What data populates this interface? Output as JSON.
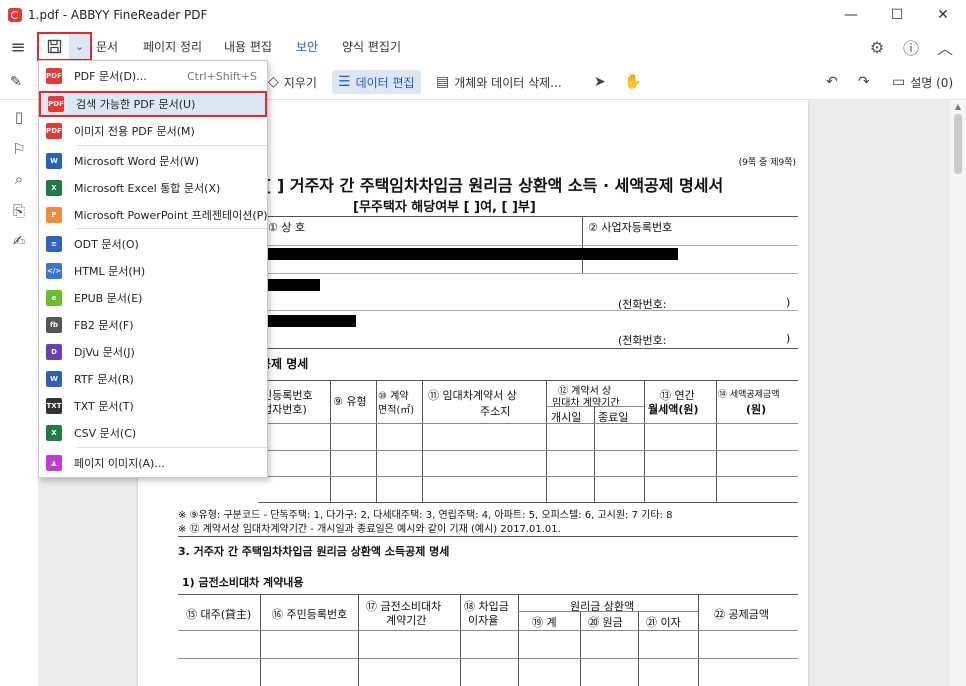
{
  "window": {
    "title": "1.pdf - ABBYY FineReader PDF",
    "minimize": "—",
    "maximize": "☐",
    "close": "✕"
  },
  "menubar": {
    "tabs": [
      "문서",
      "페이지 정리",
      "내용 편집",
      "보안",
      "양식 편집기"
    ],
    "active_tab": "보안"
  },
  "toolbar": {
    "cut_label": "지우기",
    "data_edit_label": "데이터 편집",
    "object_delete_label": "개체와 데이터 삭제...",
    "comments_label": "설명 (0)"
  },
  "colors": {
    "swatches": [
      "#e8191a",
      "#ff9800",
      "#f5e600",
      "#7ed321",
      "#1fd3d8",
      "#2b7de9",
      "#e91ee0"
    ],
    "selected": "#000000",
    "accent": "#1f5fc7",
    "highlight_border": "#e0282e"
  },
  "dropdown": {
    "items": [
      {
        "label": "PDF 문서(D)...",
        "shortcut": "Ctrl+Shift+S",
        "icon": "pdf-icon",
        "color": "#e53935",
        "glyph": "PDF"
      },
      {
        "label": "검색 가능한 PDF 문서(U)",
        "shortcut": "",
        "icon": "pdf-icon",
        "color": "#e53935",
        "glyph": "PDF"
      },
      {
        "label": "이미지 전용 PDF 문서(M)",
        "shortcut": "",
        "icon": "pdf-icon",
        "color": "#e53935",
        "glyph": "PDF"
      },
      {
        "label": "Microsoft Word 문서(W)",
        "shortcut": "",
        "icon": "word-icon",
        "color": "#2b5fbd",
        "glyph": "W"
      },
      {
        "label": "Microsoft Excel 통합 문서(X)",
        "shortcut": "",
        "icon": "excel-icon",
        "color": "#1f7a45",
        "glyph": "X"
      },
      {
        "label": "Microsoft PowerPoint 프레젠테이션(P)",
        "shortcut": "",
        "icon": "powerpoint-icon",
        "color": "#f08a3c",
        "glyph": "P"
      },
      {
        "label": "ODT 문서(O)",
        "shortcut": "",
        "icon": "odt-icon",
        "color": "#2b66c4",
        "glyph": "≡"
      },
      {
        "label": "HTML 문서(H)",
        "shortcut": "",
        "icon": "html-icon",
        "color": "#3a72d6",
        "glyph": "</>"
      },
      {
        "label": "EPUB 문서(E)",
        "shortcut": "",
        "icon": "epub-icon",
        "color": "#6abf2e",
        "glyph": "e"
      },
      {
        "label": "FB2 문서(F)",
        "shortcut": "",
        "icon": "fb2-icon",
        "color": "#555555",
        "glyph": "fb"
      },
      {
        "label": "DjVu 문서(J)",
        "shortcut": "",
        "icon": "djvu-icon",
        "color": "#6a3fb5",
        "glyph": "D"
      },
      {
        "label": "RTF 문서(R)",
        "shortcut": "",
        "icon": "rtf-icon",
        "color": "#2b5fbd",
        "glyph": "W"
      },
      {
        "label": "TXT 문서(T)",
        "shortcut": "",
        "icon": "txt-icon",
        "color": "#333333",
        "glyph": "TXT"
      },
      {
        "label": "CSV 문서(C)",
        "shortcut": "",
        "icon": "csv-icon",
        "color": "#1f7a45",
        "glyph": "X"
      },
      {
        "label": "페이지 이미지(A)...",
        "shortcut": "",
        "icon": "image-icon",
        "color": "#c23bd6",
        "glyph": "▲"
      }
    ]
  },
  "document": {
    "page_no": "(9쪽 중 제9쪽)",
    "title": "·[  ] 거주자 간 주택임차차입금 원리금 상환액 소득 · 세액공제 명세서",
    "subtitle": "[무주택자 해당여부 [   ]여, [   ]부]",
    "field_company": "① 상 호",
    "field_bizno": "② 사업자등록번호",
    "phone1": "(전화번호:",
    "phone1_end": ")",
    "phone2": "(전화번호:",
    "phone2_end": ")",
    "section_label": "공제 명세",
    "col_regno": "민등록번호",
    "col_regno2": "업자번호)",
    "col_type": "⑨ 유형",
    "col_area1": "⑩ 계약",
    "col_area2": "면적(㎡)",
    "col_addr1": "⑪ 임대차계약서 상",
    "col_addr2": "주소지",
    "col_period1": "⑫ 계약서 상",
    "col_period2": "임대차 계약기간",
    "col_start": "개시일",
    "col_end": "종료일",
    "col_rent1": "⑬ 연간",
    "col_rent2": "월세액(원)",
    "col_deduct1": "⑭ 세액공제금액",
    "col_deduct2": "(원)",
    "note1": "※ ⑨유형: 구분코드 - 단독주택: 1, 다가구: 2, 다세대주택: 3, 연립주택: 4, 아파트: 5, 오피스텔: 6, 고시원: 7 기타: 8",
    "note2": "※ ⑫ 계약서상 임대차계약기간 - 개시일과 종료일은 예시와 같이 기재 (예시) 2017.01.01.",
    "section3": "3. 거주자 간 주택임차차입금 원리금 상환액 소득공제 명세",
    "section3_1": "1) 금전소비대차 계약내용",
    "t2_lender": "⑮ 대주(貸主)",
    "t2_regno": "⑯ 주민등록번호",
    "t2_period1": "⑰ 금전소비대차",
    "t2_period2": "계약기간",
    "t2_rate1": "⑱ 차입금",
    "t2_rate2": "이자율",
    "t2_repay": "원리금 상환액",
    "t2_sum": "⑲ 계",
    "t2_principal": "⑳ 원금",
    "t2_interest": "㉑ 이자",
    "t2_deduct": "㉒ 공제금액"
  }
}
